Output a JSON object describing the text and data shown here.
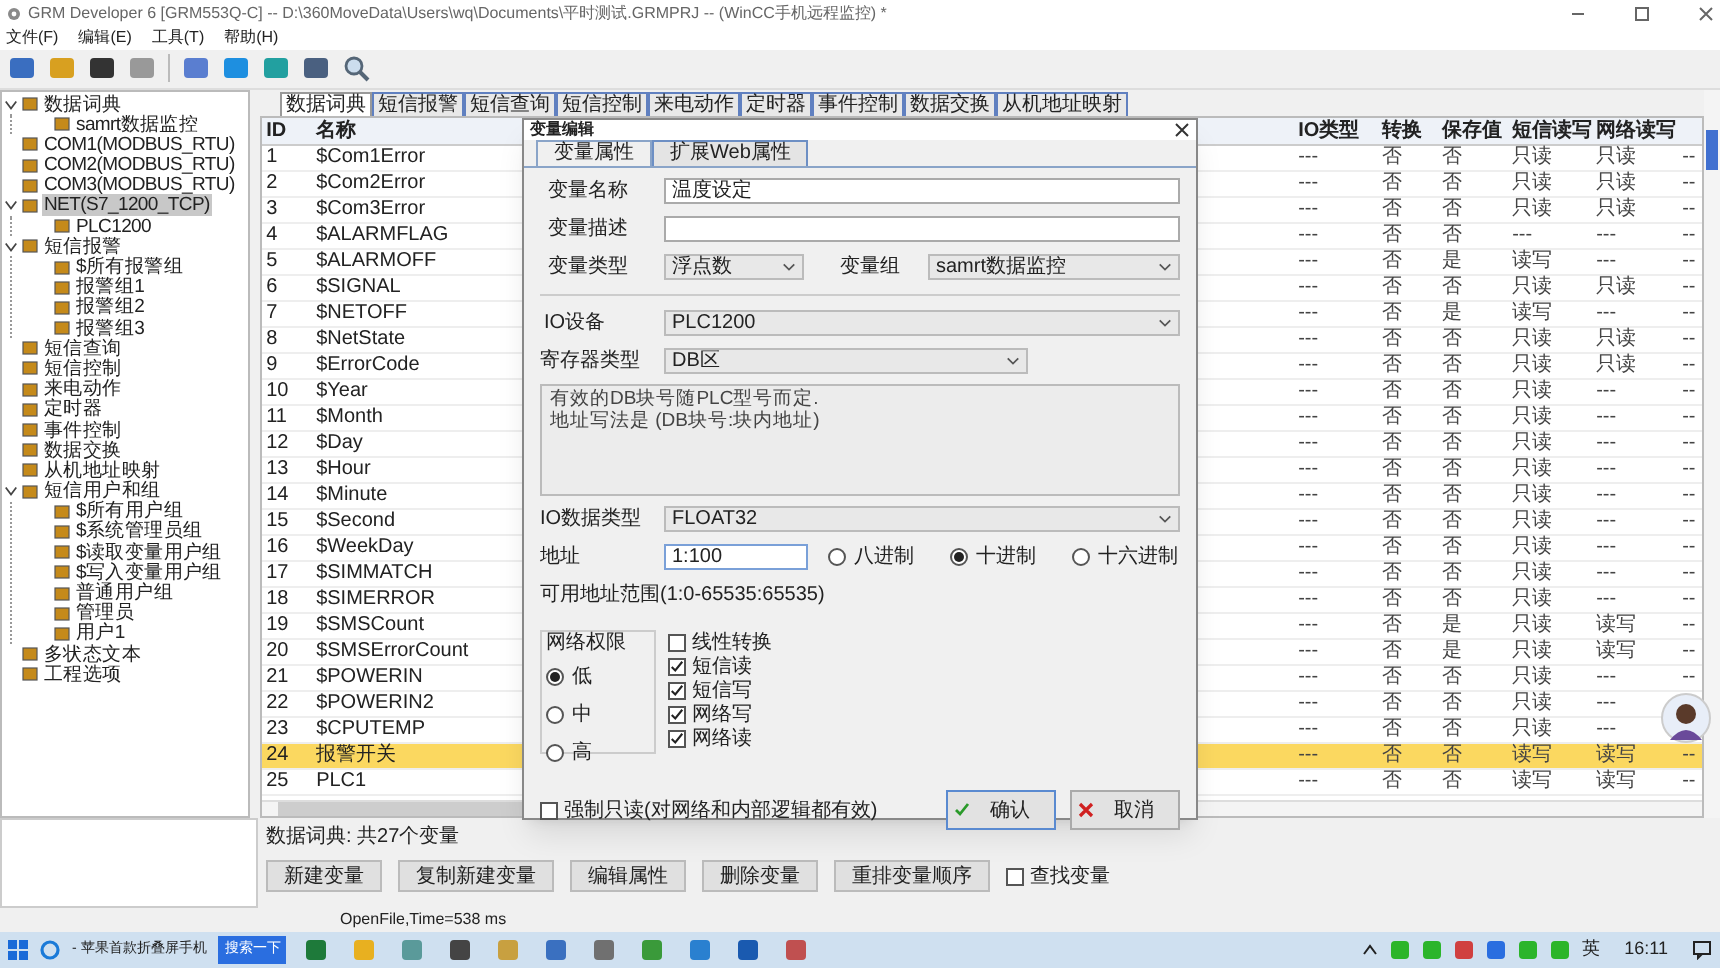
{
  "window": {
    "title": "GRM Developer 6 [GRM553Q-C]  -- D:\\360MoveData\\Users\\wq\\Documents\\平时测试.GRMPRJ -- (WinCC手机远程监控) *"
  },
  "menu": [
    "文件(F)",
    "编辑(E)",
    "工具(T)",
    "帮助(H)"
  ],
  "tree": [
    {
      "label": "数据词典",
      "selected": false,
      "expanded": true,
      "children": [
        {
          "label": "samrt数据监控",
          "selected": false
        }
      ]
    },
    {
      "label": "COM1(MODBUS_RTU)",
      "selected": false
    },
    {
      "label": "COM2(MODBUS_RTU)",
      "selected": false
    },
    {
      "label": "COM3(MODBUS_RTU)",
      "selected": false
    },
    {
      "label": "NET(S7_1200_TCP)",
      "selected": true,
      "expanded": true,
      "children": [
        {
          "label": "PLC1200",
          "selected": false
        }
      ]
    },
    {
      "label": "短信报警",
      "selected": false,
      "expanded": true,
      "children": [
        {
          "label": "$所有报警组",
          "selected": false
        },
        {
          "label": "报警组1",
          "selected": false
        },
        {
          "label": "报警组2",
          "selected": false
        },
        {
          "label": "报警组3",
          "selected": false
        }
      ]
    },
    {
      "label": "短信查询",
      "selected": false
    },
    {
      "label": "短信控制",
      "selected": false
    },
    {
      "label": "来电动作",
      "selected": false
    },
    {
      "label": "定时器",
      "selected": false
    },
    {
      "label": "事件控制",
      "selected": false
    },
    {
      "label": "数据交换",
      "selected": false
    },
    {
      "label": "从机地址映射",
      "selected": false
    },
    {
      "label": "短信用户和组",
      "selected": false,
      "expanded": true,
      "children": [
        {
          "label": "$所有用户组",
          "selected": false
        },
        {
          "label": "$系统管理员组",
          "selected": false
        },
        {
          "label": "$读取变量用户组",
          "selected": false
        },
        {
          "label": "$写入变量用户组",
          "selected": false
        },
        {
          "label": "普通用户组",
          "selected": false
        },
        {
          "label": "管理员",
          "selected": false
        },
        {
          "label": "用户1",
          "selected": false
        }
      ]
    },
    {
      "label": "多状态文本",
      "selected": false
    },
    {
      "label": "工程选项",
      "selected": false
    }
  ],
  "tabs": [
    {
      "label": "数据词典",
      "selected": true
    },
    {
      "label": "短信报警",
      "selected": false
    },
    {
      "label": "短信查询",
      "selected": false
    },
    {
      "label": "短信控制",
      "selected": false
    },
    {
      "label": "来电动作",
      "selected": false
    },
    {
      "label": "定时器",
      "selected": false
    },
    {
      "label": "事件控制",
      "selected": false
    },
    {
      "label": "数据交换",
      "selected": false
    },
    {
      "label": "从机地址映射",
      "selected": false
    }
  ],
  "table": {
    "columns": [
      "ID",
      "名称",
      "IO类型",
      "转换",
      "保存值",
      "短信读写",
      "网络读写"
    ],
    "rows": [
      {
        "cells": [
          "1",
          "$Com1Error",
          "---",
          "否",
          "否",
          "只读",
          "只读",
          "--"
        ],
        "selected": false
      },
      {
        "cells": [
          "2",
          "$Com2Error",
          "---",
          "否",
          "否",
          "只读",
          "只读",
          "--"
        ],
        "selected": false
      },
      {
        "cells": [
          "3",
          "$Com3Error",
          "---",
          "否",
          "否",
          "只读",
          "只读",
          "--"
        ],
        "selected": false
      },
      {
        "cells": [
          "4",
          "$ALARMFLAG",
          "---",
          "否",
          "否",
          "---",
          "---",
          "--"
        ],
        "selected": false
      },
      {
        "cells": [
          "5",
          "$ALARMOFF",
          "---",
          "否",
          "是",
          "读写",
          "---",
          "--"
        ],
        "selected": false
      },
      {
        "cells": [
          "6",
          "$SIGNAL",
          "---",
          "否",
          "否",
          "只读",
          "只读",
          "--"
        ],
        "selected": false
      },
      {
        "cells": [
          "7",
          "$NETOFF",
          "---",
          "否",
          "是",
          "读写",
          "---",
          "--"
        ],
        "selected": false
      },
      {
        "cells": [
          "8",
          "$NetState",
          "---",
          "否",
          "否",
          "只读",
          "只读",
          "--"
        ],
        "selected": false
      },
      {
        "cells": [
          "9",
          "$ErrorCode",
          "---",
          "否",
          "否",
          "只读",
          "只读",
          "--"
        ],
        "selected": false
      },
      {
        "cells": [
          "10",
          "$Year",
          "---",
          "否",
          "否",
          "只读",
          "---",
          "--"
        ],
        "selected": false
      },
      {
        "cells": [
          "11",
          "$Month",
          "---",
          "否",
          "否",
          "只读",
          "---",
          "--"
        ],
        "selected": false
      },
      {
        "cells": [
          "12",
          "$Day",
          "---",
          "否",
          "否",
          "只读",
          "---",
          "--"
        ],
        "selected": false
      },
      {
        "cells": [
          "13",
          "$Hour",
          "---",
          "否",
          "否",
          "只读",
          "---",
          "--"
        ],
        "selected": false
      },
      {
        "cells": [
          "14",
          "$Minute",
          "---",
          "否",
          "否",
          "只读",
          "---",
          "--"
        ],
        "selected": false
      },
      {
        "cells": [
          "15",
          "$Second",
          "---",
          "否",
          "否",
          "只读",
          "---",
          "--"
        ],
        "selected": false
      },
      {
        "cells": [
          "16",
          "$WeekDay",
          "---",
          "否",
          "否",
          "只读",
          "---",
          "--"
        ],
        "selected": false
      },
      {
        "cells": [
          "17",
          "$SIMMATCH",
          "---",
          "否",
          "否",
          "只读",
          "---",
          "--"
        ],
        "selected": false
      },
      {
        "cells": [
          "18",
          "$SIMERROR",
          "---",
          "否",
          "否",
          "只读",
          "---",
          "--"
        ],
        "selected": false
      },
      {
        "cells": [
          "19",
          "$SMSCount",
          "---",
          "否",
          "是",
          "只读",
          "读写",
          "--"
        ],
        "selected": false
      },
      {
        "cells": [
          "20",
          "$SMSErrorCount",
          "---",
          "否",
          "是",
          "只读",
          "读写",
          "--"
        ],
        "selected": false
      },
      {
        "cells": [
          "21",
          "$POWERIN",
          "---",
          "否",
          "否",
          "只读",
          "---",
          "--"
        ],
        "selected": false
      },
      {
        "cells": [
          "22",
          "$POWERIN2",
          "---",
          "否",
          "否",
          "只读",
          "---"
        ],
        "selected": false
      },
      {
        "cells": [
          "23",
          "$CPUTEMP",
          "---",
          "否",
          "否",
          "只读",
          "---"
        ],
        "selected": false
      },
      {
        "cells": [
          "24",
          "报警开关",
          "---",
          "否",
          "否",
          "读写",
          "读写",
          "--"
        ],
        "selected": true
      },
      {
        "cells": [
          "25",
          "PLC1",
          "---",
          "否",
          "否",
          "读写",
          "读写",
          "--"
        ],
        "selected": false
      }
    ]
  },
  "summary": "数据词典: 共27个变量",
  "buttons": [
    "新建变量",
    "复制新建变量",
    "编辑属性",
    "删除变量",
    "重排变量顺序"
  ],
  "find_checkbox": {
    "label": "查找变量",
    "checked": false
  },
  "status": "OpenFile,Time=538 ms",
  "dialog": {
    "title": "变量编辑",
    "tabs": [
      {
        "label": "变量属性",
        "selected": true
      },
      {
        "label": "扩展Web属性",
        "selected": false
      }
    ],
    "name": {
      "label": "变量名称",
      "value": "温度设定"
    },
    "description": {
      "label": "变量描述"
    },
    "type": {
      "label": "变量类型",
      "value": "浮点数"
    },
    "group": {
      "label": "变量组",
      "value": "samrt数据监控"
    },
    "device": {
      "label": "IO设备",
      "value": "PLC1200"
    },
    "register": {
      "label": "寄存器类型",
      "value": "DB区"
    },
    "note": [
      "有效的DB块号随PLC型号而定.",
      "地址写法是 (DB块号:块内地址)"
    ],
    "data_type": {
      "label": "IO数据类型",
      "value": "FLOAT32"
    },
    "address": {
      "label": "地址",
      "value": "1:100"
    },
    "radix": [
      {
        "label": "八进制",
        "selected": false
      },
      {
        "label": "十进制",
        "selected": true
      },
      {
        "label": "十六进制",
        "selected": false
      }
    ],
    "range": "可用地址范围(1:0-65535:65535)",
    "permission": {
      "title": "网络权限",
      "options": [
        {
          "label": "低",
          "selected": true
        },
        {
          "label": "中",
          "selected": false
        },
        {
          "label": "高",
          "selected": false
        }
      ]
    },
    "checks": [
      {
        "label": "线性转换",
        "checked": false
      },
      {
        "label": "短信读",
        "checked": true
      },
      {
        "label": "短信写",
        "checked": true
      },
      {
        "label": "网络写",
        "checked": true
      },
      {
        "label": "网络读",
        "checked": true
      }
    ],
    "readonly": {
      "label": "强制只读(对网络和内部逻辑都有效)",
      "checked": false
    },
    "ok": "确认",
    "cancel": "取消"
  },
  "taskbar": {
    "browser_item": "- 苹果首款折叠屏手机",
    "search_button": "搜索一下",
    "ime": "英",
    "clock": "16:11"
  }
}
